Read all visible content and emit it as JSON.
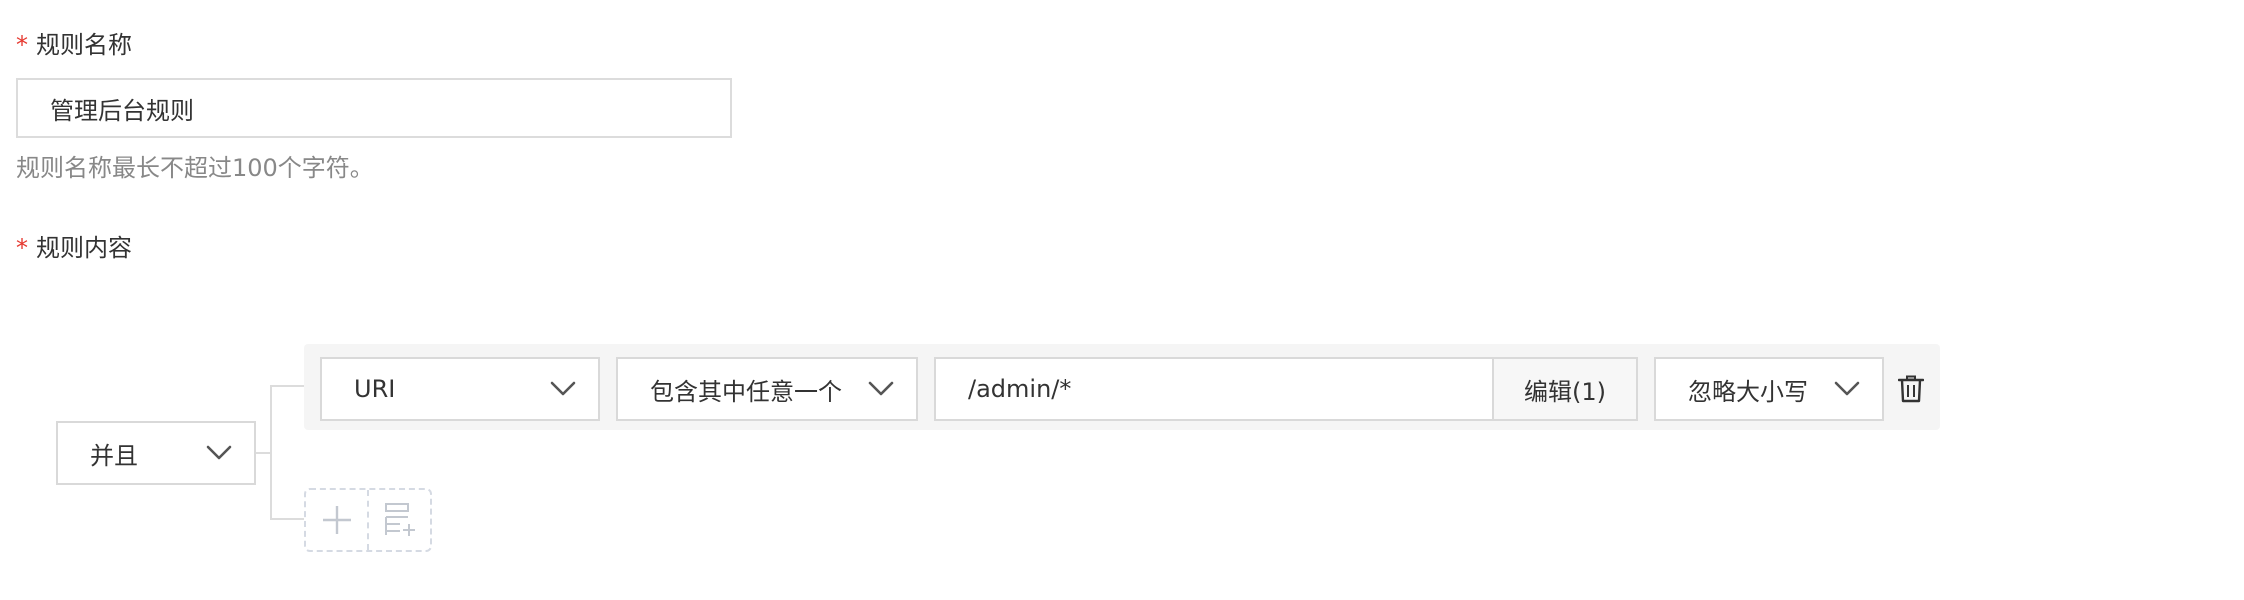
{
  "rule_name": {
    "required_mark": "*",
    "label": "规则名称",
    "value": "管理后台规则",
    "hint": "规则名称最长不超过100个字符。"
  },
  "rule_content": {
    "required_mark": "*",
    "label": "规则内容",
    "logic_operator": "并且",
    "conditions": [
      {
        "field": "URI",
        "operator": "包含其中任意一个",
        "value": "/admin/*",
        "edit_label": "编辑(1)",
        "case_option": "忽略大小写"
      }
    ]
  },
  "icons": {
    "chevron": "chevron-down-icon",
    "delete": "trash-icon",
    "add_condition": "plus-icon",
    "add_group": "add-group-icon"
  }
}
